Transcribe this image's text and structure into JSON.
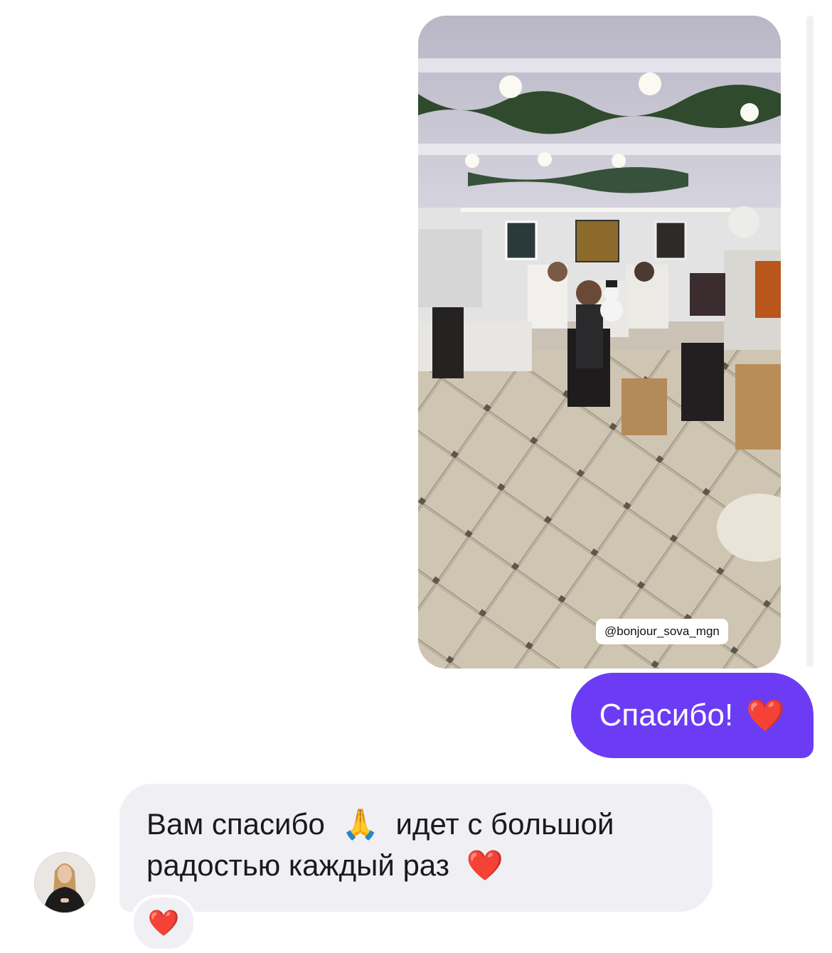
{
  "conversation": {
    "media_message": {
      "watermark": "@bonjour_sova_mgn"
    },
    "outgoing_message": {
      "text": "Спасибо!",
      "emoji": "❤️"
    },
    "incoming_message": {
      "line1_before": "Вам спасибо",
      "line1_emoji": "🙏",
      "line1_after": "идет с большой",
      "line2_text": "радостью каждый раз",
      "line2_emoji": "❤️",
      "reaction": "❤️"
    }
  },
  "colors": {
    "outgoing_bubble": "#6c3cf4",
    "incoming_bubble": "#f0f0f4",
    "heart": "#e5202f"
  }
}
